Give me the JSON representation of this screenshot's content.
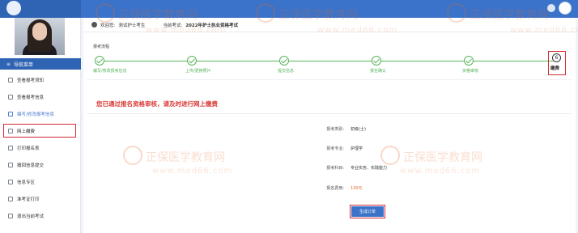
{
  "user_bar": {
    "welcome": "欢迎您:",
    "name": "测试护士考生",
    "exam_label": "当前考试:",
    "exam_name": "2022年护士执业资格考试"
  },
  "sidebar": {
    "header": "导航菜单",
    "items": [
      {
        "label": "查看报考须知"
      },
      {
        "label": "查看报考信息"
      },
      {
        "label": "编写/修改报考信息"
      },
      {
        "label": "网上缴费"
      },
      {
        "label": "打印报名表"
      },
      {
        "label": "撤回信息提交"
      },
      {
        "label": "信息专区"
      },
      {
        "label": "准考证打印"
      },
      {
        "label": "退出当前考试"
      }
    ]
  },
  "steps": {
    "title": "报考流程",
    "items": [
      {
        "label": "编写/修改报考信息"
      },
      {
        "label": "上传/更换照片"
      },
      {
        "label": "提交信息"
      },
      {
        "label": "报名确认"
      },
      {
        "label": "资格审核"
      }
    ],
    "final": {
      "number": "6",
      "label": "缴费"
    }
  },
  "notice": "您已通过报名资格审核，请及时进行网上缴费",
  "info": [
    {
      "key": "报考类别:",
      "value": "初级(士)"
    },
    {
      "key": "报考专业:",
      "value": "护理学"
    },
    {
      "key": "报考科目:",
      "value": "专业实务、实践能力"
    },
    {
      "key": "报名费用:",
      "value": "130元"
    }
  ],
  "generate_button": "生成订单",
  "watermarks": {
    "brand": "正保医学教育网",
    "url": "www.med66.com"
  },
  "colors": {
    "primary": "#3a73c9",
    "success": "#58b45b",
    "alert": "#d93a36",
    "highlight_border": "#d42a33"
  }
}
